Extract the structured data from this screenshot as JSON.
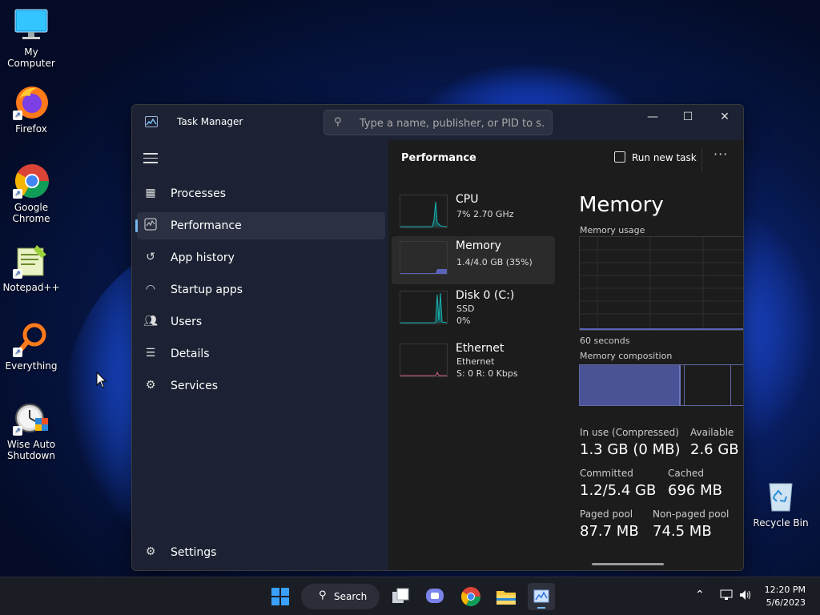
{
  "desktop": {
    "icons": [
      {
        "label": "My Computer",
        "icon": "monitor-icon"
      },
      {
        "label": "Firefox",
        "icon": "firefox-icon"
      },
      {
        "label": "Google Chrome",
        "icon": "chrome-icon"
      },
      {
        "label": "Notepad++",
        "icon": "notepadpp-icon"
      },
      {
        "label": "Everything",
        "icon": "everything-icon"
      },
      {
        "label": "Wise Auto Shutdown",
        "icon": "wise-auto-shutdown-icon"
      }
    ],
    "recycle_bin": {
      "label": "Recycle Bin",
      "icon": "recycle-bin-icon"
    }
  },
  "window": {
    "title": "Task Manager",
    "search_placeholder": "Type a name, publisher, or PID to s...",
    "controls": {
      "minimize": "—",
      "maximize": "☐",
      "close": "✕"
    }
  },
  "sidebar": {
    "items": [
      {
        "label": "Processes",
        "icon": "processes-icon",
        "active": false
      },
      {
        "label": "Performance",
        "icon": "performance-icon",
        "active": true
      },
      {
        "label": "App history",
        "icon": "history-icon",
        "active": false
      },
      {
        "label": "Startup apps",
        "icon": "startup-icon",
        "active": false
      },
      {
        "label": "Users",
        "icon": "users-icon",
        "active": false
      },
      {
        "label": "Details",
        "icon": "details-icon",
        "active": false
      },
      {
        "label": "Services",
        "icon": "services-icon",
        "active": false
      }
    ],
    "settings_label": "Settings"
  },
  "performance": {
    "title": "Performance",
    "run_new_task": "Run new task",
    "more": "···",
    "resources": [
      {
        "name": "CPU",
        "sub1": "7% 2.70 GHz",
        "sub2": "",
        "sub3": ""
      },
      {
        "name": "Memory",
        "sub1": "1.4/4.0 GB (35%)",
        "sub2": "",
        "sub3": ""
      },
      {
        "name": "Disk 0 (C:)",
        "sub1": "SSD",
        "sub2": "0%",
        "sub3": ""
      },
      {
        "name": "Ethernet",
        "sub1": "Ethernet",
        "sub2": "S: 0 R: 0 Kbps",
        "sub3": ""
      }
    ],
    "memory": {
      "heading": "Memory",
      "usage_label": "Memory usage",
      "time_label": "60 seconds",
      "composition_label": "Memory composition",
      "stats": [
        {
          "label": "In use (Compressed)",
          "value": "1.3 GB (0 MB)"
        },
        {
          "label": "Available",
          "value": "2.6 GB"
        },
        {
          "label": "Committed",
          "value": "1.2/5.4 GB"
        },
        {
          "label": "Cached",
          "value": "696 MB"
        },
        {
          "label": "Paged pool",
          "value": "87.7 MB"
        },
        {
          "label": "Non-paged pool",
          "value": "74.5 MB"
        }
      ]
    }
  },
  "taskbar": {
    "search_label": "Search",
    "apps": [
      "windows-start-icon",
      "task-view-icon",
      "teams-chat-icon",
      "chrome-icon",
      "file-explorer-icon",
      "task-manager-icon"
    ],
    "tray": [
      "chevron-up-icon",
      "network-icon",
      "volume-icon"
    ],
    "time": "12:20 PM",
    "date": "5/6/2023"
  },
  "colors": {
    "accent": "#76b9ed",
    "cpu_line": "#17b3b3",
    "memory_fill": "#5b64b8",
    "sidebar_bg": "#1c2233",
    "main_bg": "#1c1c1c"
  }
}
